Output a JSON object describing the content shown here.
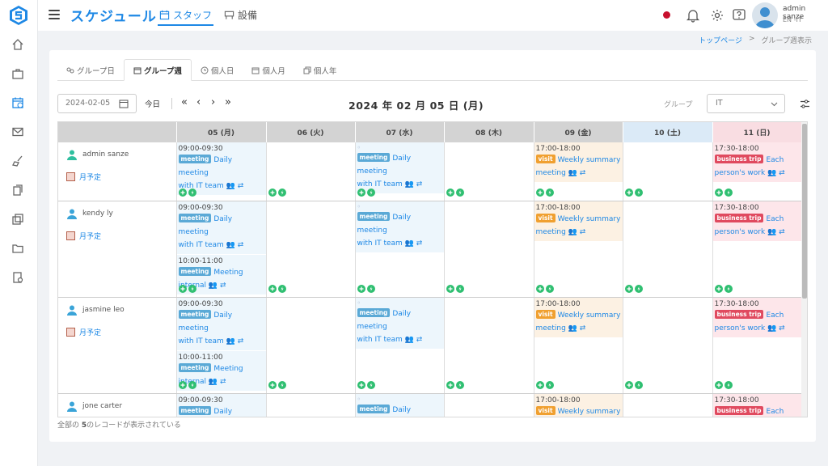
{
  "header": {
    "app_title": "スケジュール",
    "nav_staff": "スタッフ",
    "nav_equipment": "設備",
    "user_name": "admin sanze",
    "user_lang": "EN -IT"
  },
  "breadcrumb": {
    "home": "トップページ",
    "separator": ">",
    "current": "グループ週表示"
  },
  "tabs": [
    {
      "label": "グループ日",
      "icon": "group-day-icon"
    },
    {
      "label": "グループ週",
      "icon": "calendar-icon"
    },
    {
      "label": "個人日",
      "icon": "clock-icon"
    },
    {
      "label": "個人月",
      "icon": "calendar-icon"
    },
    {
      "label": "個人年",
      "icon": "copy-icon"
    }
  ],
  "toolbar": {
    "date_value": "2024-02-05",
    "today_label": "今日",
    "period": "2024 年 02 月 05 日 (月)",
    "group_label": "グループ",
    "group_value": "IT"
  },
  "days": [
    {
      "label": "05 (月)"
    },
    {
      "label": "06 (火)"
    },
    {
      "label": "07 (水)"
    },
    {
      "label": "08 (木)"
    },
    {
      "label": "09 (金)"
    },
    {
      "label": "10 (土)"
    },
    {
      "label": "11 (日)"
    }
  ],
  "month_plan_label": "月予定",
  "events": {
    "daily_time": "09:00-09:30",
    "daily_title_1": "Daily meeting",
    "daily_title_2": "with IT team",
    "internal_time": "10:00-11:00",
    "internal_title_1": "Meeting",
    "internal_title_2": "internal",
    "wed_marker": "◦",
    "weekly_time": "17:00-18:00",
    "weekly_title_1": "Weekly summary",
    "weekly_title_2": "meeting",
    "trip_time": "17:30-18:00",
    "trip_title_1": "Each",
    "trip_title_2": "person's work",
    "badge_meeting": "meeting",
    "badge_visit": "visit",
    "badge_trip": "business trip"
  },
  "users": [
    {
      "name": "admin sanze"
    },
    {
      "name": "kendy ly"
    },
    {
      "name": "jasmine leo"
    },
    {
      "name": "jone carter"
    }
  ],
  "footer": {
    "prefix": "全部の",
    "count": "5",
    "suffix": "のレコードが表示されている"
  },
  "colors": {
    "accent": "#1e88e5",
    "meeting": "#5aa9d6",
    "visit": "#f0a030",
    "trip": "#e04a5f",
    "add": "#2fbf71"
  }
}
